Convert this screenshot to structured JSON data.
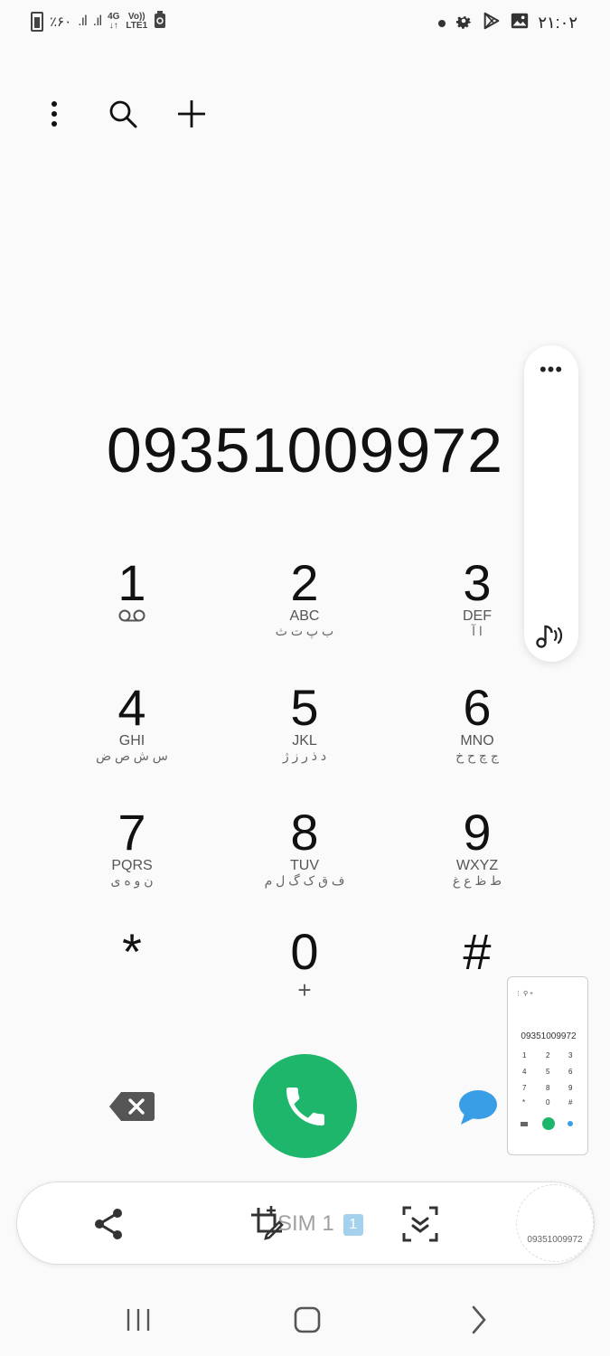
{
  "status_bar": {
    "battery_text": "٪۶۰",
    "network_4g": "4G",
    "volte_top": "Vo))",
    "volte_bottom": "LTE1",
    "time": "۲۱:۰۲"
  },
  "toolbar": {
    "icons": [
      "more-vert-icon",
      "search-icon",
      "add-icon"
    ]
  },
  "dialer": {
    "number": "09351009972"
  },
  "keypad": [
    {
      "digit": "1",
      "latin": "",
      "farsi": "",
      "extra": "voicemail-icon"
    },
    {
      "digit": "2",
      "latin": "ABC",
      "farsi": "ب پ ت ث"
    },
    {
      "digit": "3",
      "latin": "DEF",
      "farsi": "ا آ"
    },
    {
      "digit": "4",
      "latin": "GHI",
      "farsi": "س ش ص ض"
    },
    {
      "digit": "5",
      "latin": "JKL",
      "farsi": "د ذ ر ز ژ"
    },
    {
      "digit": "6",
      "latin": "MNO",
      "farsi": "ج چ ح خ"
    },
    {
      "digit": "7",
      "latin": "PQRS",
      "farsi": "ن و ه ی"
    },
    {
      "digit": "8",
      "latin": "TUV",
      "farsi": "ف ق ک گ ل م"
    },
    {
      "digit": "9",
      "latin": "WXYZ",
      "farsi": "ط ظ ع غ"
    },
    {
      "digit": "*",
      "latin": "",
      "farsi": ""
    },
    {
      "digit": "0",
      "latin": "+",
      "farsi": ""
    },
    {
      "digit": "#",
      "latin": "",
      "farsi": ""
    }
  ],
  "side_panel": {
    "more_label": "•••",
    "icon": "sound-icon"
  },
  "actions": {
    "backspace_icon": "backspace-icon",
    "call_icon": "phone-icon",
    "message_icon": "message-icon",
    "call_color": "#1db66b"
  },
  "thumbnail": {
    "number": "09351009972",
    "keys": [
      "1",
      "2",
      "3",
      "4",
      "5",
      "6",
      "7",
      "8",
      "9",
      "*",
      "0",
      "#"
    ]
  },
  "bottom_toolbar": {
    "sim_label": "SIM 1",
    "sim_badge": "1",
    "number_preview": "09351009972"
  },
  "nav_bar": {
    "icons": [
      "recents-icon",
      "home-icon",
      "back-icon"
    ]
  }
}
